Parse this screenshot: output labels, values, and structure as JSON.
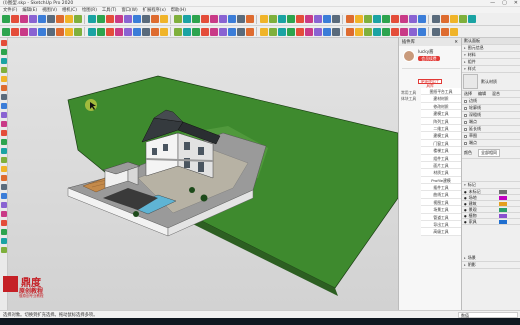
{
  "app": {
    "title": "(l)图型.skp - SketchUp Pro 2020",
    "window_buttons": [
      "—",
      "▢",
      "✕"
    ]
  },
  "menu": [
    "文件(F)",
    "编辑(E)",
    "视图(V)",
    "相机(C)",
    "绘图(R)",
    "工具(T)",
    "窗口(W)",
    "扩展程序(x)",
    "帮助(H)"
  ],
  "plugin_panel": {
    "header_title": "插件库",
    "close": "✕",
    "username": "lucky酱",
    "user_button": "会员续费",
    "active_tab": "便捷使用工具库",
    "categories": [
      "常用工具",
      "体块工具"
    ],
    "items": [
      "图纸平台工具",
      "建材材质",
      "修改材质",
      "建模工具",
      "阵列工具",
      "二维工具",
      "建模工具",
      "门窗工具",
      "楼梯工具",
      "组件工具",
      "面片工具",
      "材质工具",
      "Profile建模",
      "插件工具",
      "曲线工具",
      "视图工具",
      "场景工具",
      "管道工具",
      "导出工具",
      "高级工具"
    ]
  },
  "default_tray": {
    "title": "默认面板",
    "sections": [
      "图元信息",
      "材料",
      "组件",
      "样式"
    ],
    "material_name": "默认材质",
    "tabs": [
      "选择",
      "编辑",
      "混合"
    ],
    "prop_labels": [
      "边线",
      "轮廓线",
      "深粗线",
      "端点",
      "延长线",
      "草图",
      "端点"
    ],
    "style_label": "颜色",
    "style_value": "全部相同",
    "layers_section": "标记",
    "layers": [
      {
        "name": "未标记",
        "color": "#6e7070"
      },
      {
        "name": "场地",
        "color": "#c000c0"
      },
      {
        "name": "建筑",
        "color": "#e5a020"
      },
      {
        "name": "景观",
        "color": "#2aa06a"
      },
      {
        "name": "植物",
        "color": "#8a50d0"
      },
      {
        "name": "家具",
        "color": "#1f6fd0"
      }
    ],
    "footer_items": [
      "场景",
      "阴影"
    ]
  },
  "status": {
    "text": "选择对象。切换到扩充选择。拖动鼠标选择多项。",
    "measure_label": "数值"
  },
  "watermark": {
    "big": "鼎度",
    "sub": "原创教程",
    "tiny": "做原创专业教程"
  },
  "colors": {
    "grass": "#3e8a2e",
    "grass_dark": "#2f6e22",
    "accent": "#c52026"
  }
}
